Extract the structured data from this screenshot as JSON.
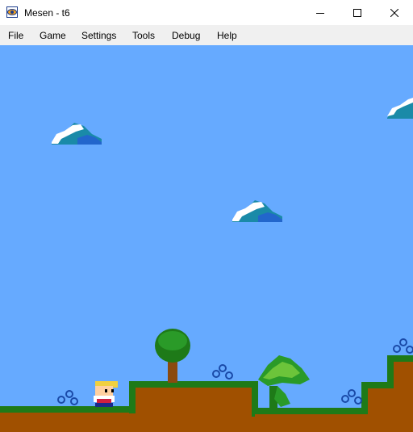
{
  "window": {
    "title": "Mesen - t6",
    "icon": "mesen-eye-icon",
    "controls": [
      "minimize",
      "maximize",
      "close"
    ]
  },
  "menu": {
    "items": [
      "File",
      "Game",
      "Settings",
      "Tools",
      "Debug",
      "Help"
    ]
  },
  "game": {
    "sky_color": "#66aaff",
    "ground_color": "#a05000",
    "grass_color": "#1e7a18",
    "cloud_color": "#ffffff",
    "cloud_shadow_color": "#1a8aa8"
  }
}
